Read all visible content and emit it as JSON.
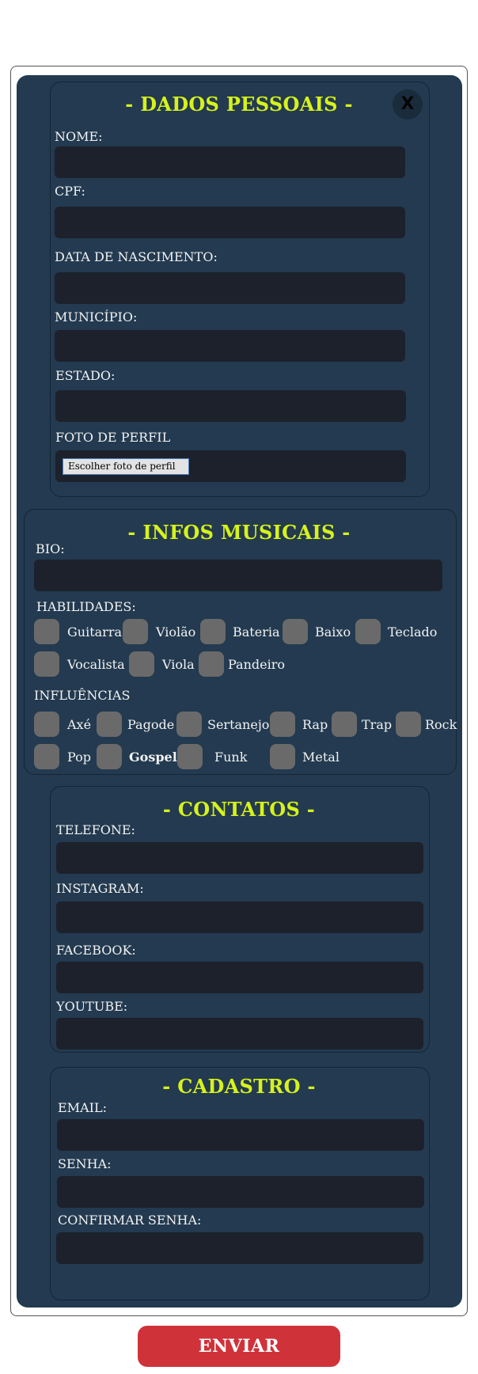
{
  "close_label": "X",
  "dados": {
    "title": "- DADOS PESSOAIS -",
    "nome_label": "NOME:",
    "nome_value": "",
    "cpf_label": "CPF:",
    "cpf_value": "",
    "nascimento_label": "DATA DE NASCIMENTO:",
    "nascimento_value": "",
    "municipio_label": "MUNICÍPIO:",
    "municipio_value": "",
    "estado_label": "ESTADO:",
    "estado_value": "",
    "foto_label": "FOTO DE PERFIL",
    "foto_button": "Escolher foto de perfil"
  },
  "musicais": {
    "title": "- INFOS MUSICAIS -",
    "bio_label": "BIO:",
    "bio_value": "",
    "habilidades_label": "HABILIDADES:",
    "habilidades": [
      "Guitarra",
      "Violão",
      "Bateria",
      "Baixo",
      "Teclado",
      "Vocalista",
      "Viola",
      "Pandeiro"
    ],
    "influencias_label": "INFLUÊNCIAS",
    "influencias": [
      "Axé",
      "Pagode",
      "Sertanejo",
      "Rap",
      "Trap",
      "Rock",
      "Pop",
      "Gospel",
      "Funk",
      "Metal"
    ]
  },
  "contatos": {
    "title": "- CONTATOS -",
    "telefone_label": "TELEFONE:",
    "telefone_value": "",
    "instagram_label": "INSTAGRAM:",
    "instagram_value": "",
    "facebook_label": "FACEBOOK:",
    "facebook_value": "",
    "youtube_label": "YOUTUBE:",
    "youtube_value": ""
  },
  "cadastro": {
    "title": "- CADASTRO -",
    "email_label": "EMAIL:",
    "email_value": "",
    "senha_label": "SENHA:",
    "senha_value": "",
    "confirmar_label": "CONFIRMAR SENHA:",
    "confirmar_value": ""
  },
  "submit_label": "ENVIAR",
  "colors": {
    "title_accent": "#d6f21a",
    "panel_bg": "#233a50",
    "input_bg": "#1c212b",
    "submit_bg": "#d0323a"
  }
}
